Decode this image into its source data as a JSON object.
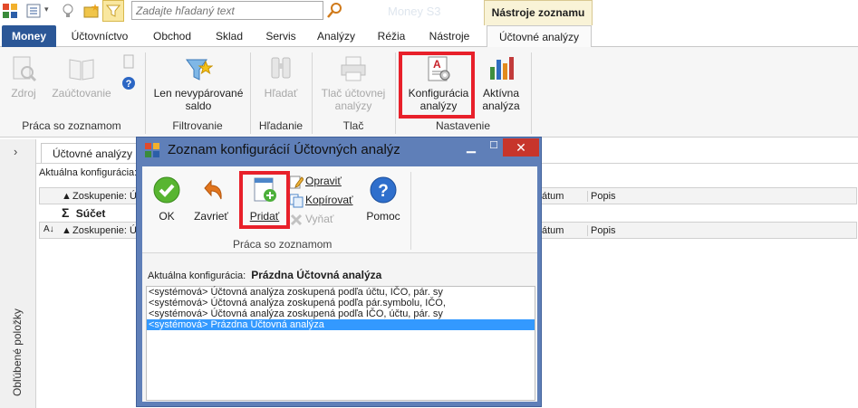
{
  "search": {
    "placeholder": "Zadajte hľadaný text"
  },
  "app": {
    "title": "Money S3"
  },
  "context_tab": {
    "label": "Nástroje zoznamu"
  },
  "tabs": [
    {
      "label": "Money"
    },
    {
      "label": "Účtovníctvo"
    },
    {
      "label": "Obchod"
    },
    {
      "label": "Sklad"
    },
    {
      "label": "Servis"
    },
    {
      "label": "Analýzy"
    },
    {
      "label": "Réžia"
    },
    {
      "label": "Nástroje"
    },
    {
      "label": "Účtovné analýzy"
    }
  ],
  "ribbon": {
    "zdroj": "Zdroj",
    "zauctovanie": "Zaúčtovanie",
    "len_nevyparovane": "Len nevypárované",
    "len_nevyparovane_2": "saldo",
    "hladat": "Hľadať",
    "tlac_1": "Tlač účtovnej",
    "tlac_2": "analýzy",
    "konfig_1": "Konfigurácia",
    "konfig_2": "analýzy",
    "aktivna_1": "Aktívna",
    "aktivna_2": "analýza",
    "groups": {
      "praca": "Práca so zoznamom",
      "filtrovanie": "Filtrovanie",
      "hladanie": "Hľadanie",
      "tlac": "Tlač",
      "nastavenie": "Nastavenie"
    }
  },
  "left_panel": {
    "label": "Obľúbené položky"
  },
  "document": {
    "tab": "Účtovné analýzy",
    "config_label": "Aktuálna konfigurácia:",
    "group_col": "Zoskupenie: Úč",
    "datum_col": "átum",
    "popis_col": "Popis",
    "sum_label": "Súčet"
  },
  "dialog": {
    "title": "Zoznam konfigurácií Účtovných analýz",
    "ok": "OK",
    "zavriet": "Zavrieť",
    "pridat": "Pridať",
    "opravit": "Opraviť",
    "kopirovat": "Kopírovať",
    "vynat": "Vyňať",
    "pomoc": "Pomoc",
    "group": "Práca so zoznamom",
    "config_label": "Aktuálna konfigurácia:",
    "config_value": "Prázdna Účtovná analýza",
    "items": [
      "<systémová> Účtovná analýza zoskupená podľa účtu, IČO, pár. sy",
      "<systémová> Účtovná analýza zoskupená podľa pár.symbolu, IČO,",
      "<systémová> Účtovná analýza zoskupená podľa IČO, účtu, pár. sy",
      "<systémová> Prázdna Účtovná analýza"
    ],
    "selected_index": 3
  },
  "colors": {
    "accent": "#2b5797",
    "highlight": "#e8202a",
    "selection": "#3399ff",
    "dialog_frame": "#5f7fb8"
  },
  "icons": [
    "app-logo-icon",
    "list-icon",
    "lightbulb-icon",
    "folder-star-icon",
    "filter-icon",
    "search-icon",
    "source-icon",
    "book-icon",
    "help-icon",
    "funnel-star-icon",
    "binoculars-icon",
    "printer-icon",
    "config-icon",
    "chart-icon",
    "ok-icon",
    "undo-icon",
    "add-icon",
    "edit-icon",
    "copy-icon",
    "delete-icon",
    "help-circle-icon"
  ]
}
